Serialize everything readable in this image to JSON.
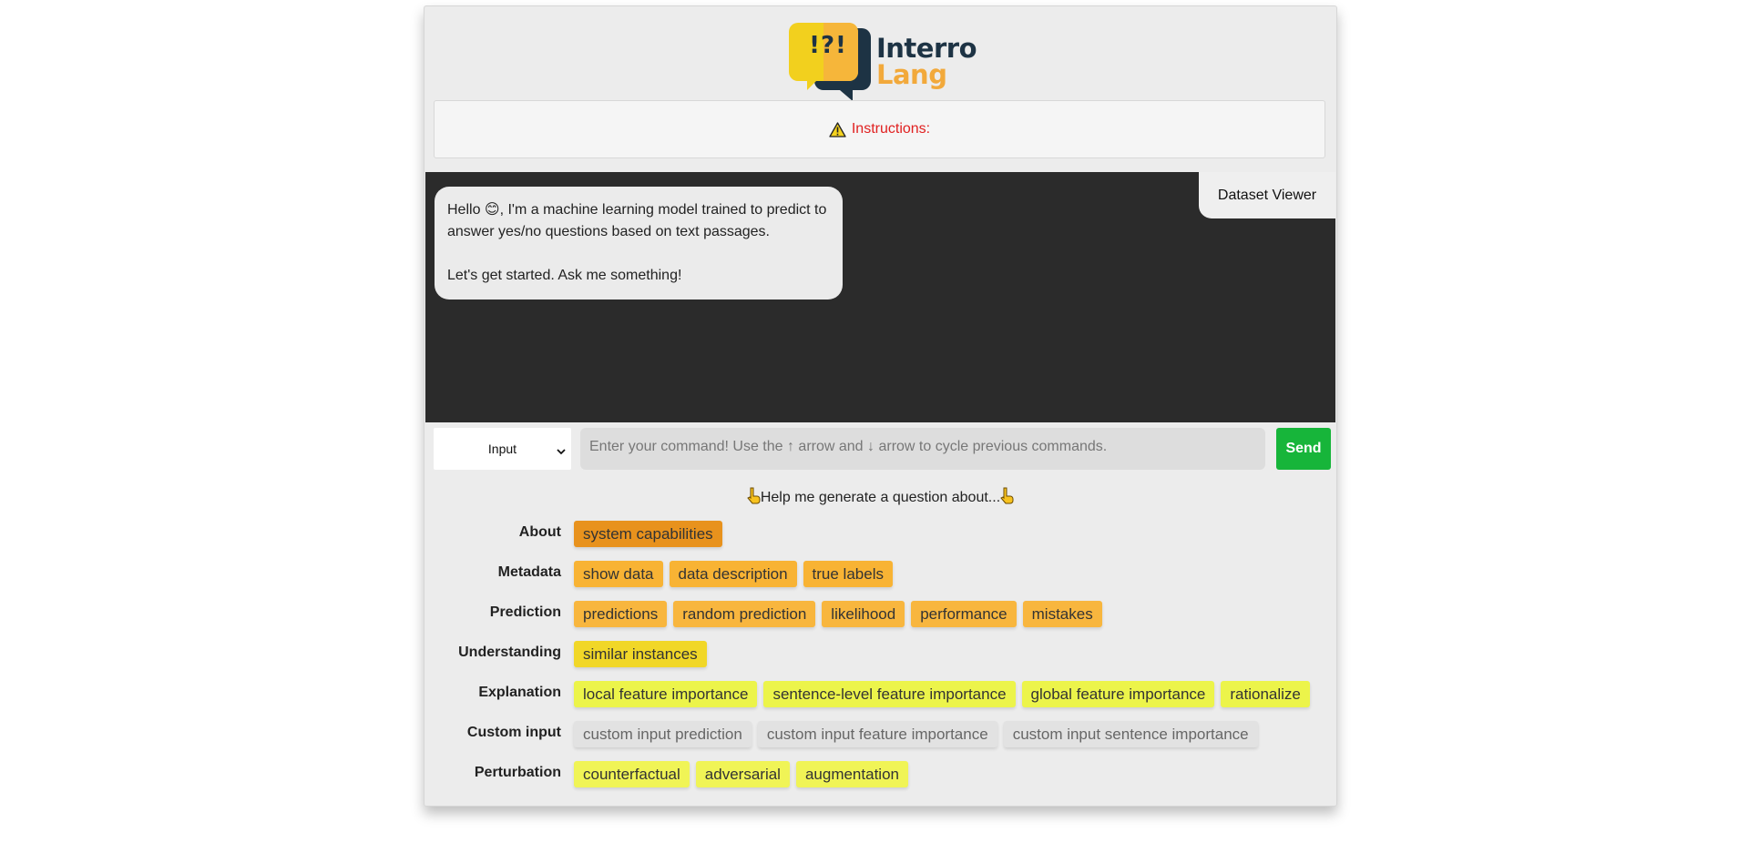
{
  "header": {
    "logo_badge": "!?!",
    "logo_line1": "Interro",
    "logo_line2": "Lang",
    "instructions_label": "Instructions:"
  },
  "chat": {
    "message_line1": "Hello 😊, I'm a machine learning model trained to predict to answer yes/no questions based on text passages.",
    "message_line2": "Let's get started. Ask me something!",
    "dataset_viewer_label": "Dataset Viewer"
  },
  "input": {
    "mode_value": "Input",
    "placeholder": "Enter your command! Use the ↑ arrow and ↓ arrow to cycle previous commands.",
    "send_label": "Send"
  },
  "help": {
    "text": "Help me generate a question about..."
  },
  "categories": [
    {
      "label": "About",
      "chips": [
        "system capabilities"
      ]
    },
    {
      "label": "Metadata",
      "chips": [
        "show data",
        "data description",
        "true labels"
      ]
    },
    {
      "label": "Prediction",
      "chips": [
        "predictions",
        "random prediction",
        "likelihood",
        "performance",
        "mistakes"
      ]
    },
    {
      "label": "Understanding",
      "chips": [
        "similar instances"
      ]
    },
    {
      "label": "Explanation",
      "chips": [
        "local feature importance",
        "sentence-level feature importance",
        "global feature importance",
        "rationalize"
      ]
    },
    {
      "label": "Custom input",
      "chips": [
        "custom input prediction",
        "custom input feature importance",
        "custom input sentence importance"
      ]
    },
    {
      "label": "Perturbation",
      "chips": [
        "counterfactual",
        "adversarial",
        "augmentation"
      ]
    }
  ],
  "colors": {
    "about": "#e8921d",
    "metadata": "#f8b334",
    "prediction": "#f8b63e",
    "understanding": "#f1d728",
    "explanation": "#ecf44a",
    "custom_input": "#e2e2e2",
    "perturbation": "#f0f456",
    "send": "#17b53a",
    "chat_bg": "#2b2b2b"
  }
}
